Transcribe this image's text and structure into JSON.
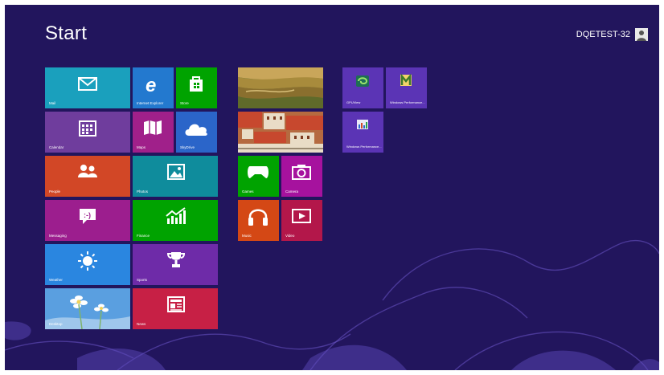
{
  "screen": {
    "title": "Start",
    "user_name": "DQETEST-32",
    "background_color": "#22155d"
  },
  "tiles": [
    {
      "label": "Mail",
      "color": "#1aa0bd",
      "icon": "mail-icon"
    },
    {
      "label": "Internet Explorer",
      "color": "#2379cf",
      "icon": "internet-explorer-icon"
    },
    {
      "label": "Store",
      "color": "#00a300",
      "icon": "store-bag-icon"
    },
    {
      "label": "Calendar",
      "color": "#6f3d9d",
      "icon": "calendar-icon"
    },
    {
      "label": "Maps",
      "color": "#a0208a",
      "icon": "map-icon"
    },
    {
      "label": "SkyDrive",
      "color": "#2b65c9",
      "icon": "cloud-icon"
    },
    {
      "label": "People",
      "color": "#d24726",
      "icon": "people-icon"
    },
    {
      "label": "Photos",
      "color": "#0f8c9c",
      "icon": "photo-icon"
    },
    {
      "label": "Messaging",
      "color": "#9c1e8e",
      "icon": "messaging-icon"
    },
    {
      "label": "Finance",
      "color": "#00a300",
      "icon": "finance-chart-icon"
    },
    {
      "label": "Weather",
      "color": "#2a86e0",
      "icon": "sun-icon"
    },
    {
      "label": "Sports",
      "color": "#6e2ba8",
      "icon": "trophy-icon"
    },
    {
      "label": "Desktop",
      "color": "#3d8bd8",
      "icon": "desktop-flower-icon"
    },
    {
      "label": "News",
      "color": "#c72045",
      "icon": "newspaper-icon"
    },
    {
      "label": "Bing",
      "color": "#8a7a3a",
      "icon": "landscape-photo"
    },
    {
      "label": "Travel",
      "color": "#9a5030",
      "icon": "city-photo"
    },
    {
      "label": "Games",
      "color": "#00a300",
      "icon": "game-controller-icon"
    },
    {
      "label": "Camera",
      "color": "#a6129e",
      "icon": "camera-icon"
    },
    {
      "label": "Music",
      "color": "#d44815",
      "icon": "headphones-icon"
    },
    {
      "label": "Video",
      "color": "#b3174a",
      "icon": "video-play-icon"
    },
    {
      "label": "GPUView",
      "color": "#5b34b5",
      "icon": "gpuview-icon"
    },
    {
      "label": "Windows Performance...",
      "color": "#5b34b5",
      "icon": "windows-performance-icon"
    },
    {
      "label": "Windows Performance...",
      "color": "#5b34b5",
      "icon": "windows-performance-analyzer-icon"
    }
  ]
}
